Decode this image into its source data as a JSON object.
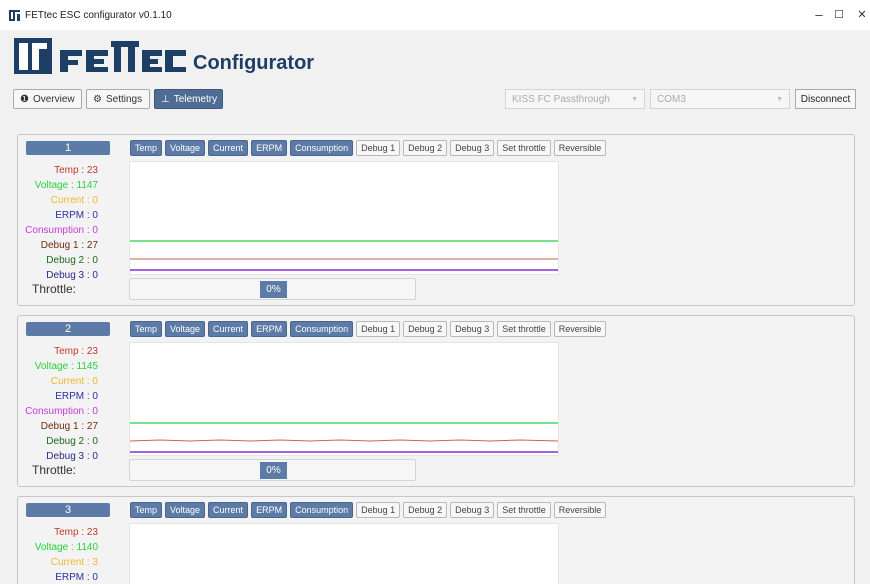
{
  "window": {
    "title": "FETtec ESC configurator v0.1.10",
    "minimize": "–",
    "maximize": "☐",
    "close": "✕"
  },
  "header": {
    "logo_text": "FETEC",
    "subtitle": "Configurator"
  },
  "nav": {
    "overview": {
      "label": "Overview",
      "icon": "info-icon"
    },
    "settings": {
      "label": "Settings",
      "icon": "gear-icon"
    },
    "telemetry": {
      "label": "Telemetry",
      "icon": "chart-icon"
    }
  },
  "controls": {
    "mode_select": "KISS FC Passthrough",
    "port_select": "COM3",
    "disconnect_label": "Disconnect"
  },
  "toggle_labels": [
    "Temp",
    "Voltage",
    "Current",
    "ERPM",
    "Consumption",
    "Debug 1",
    "Debug 2",
    "Debug 3",
    "Set throttle",
    "Reversible"
  ],
  "toggle_active": [
    true,
    true,
    true,
    true,
    true,
    false,
    false,
    false,
    false,
    false
  ],
  "colors": {
    "accent": "#5c7ba7",
    "temp": "#c0392b",
    "voltage": "#27d13a",
    "current": "#f2b631",
    "erpm": "#2c2ca8",
    "consumption": "#c53bd6"
  },
  "motors": [
    {
      "number": "1",
      "temp": "Temp : 23",
      "voltage": "Voltage : 1147",
      "current": "Current : 0",
      "erpm": "ERPM : 0",
      "consumption": "Consumption : 0",
      "debug1": "Debug 1 : 27",
      "debug2": "Debug 2 : 0",
      "debug3": "Debug 3 : 0",
      "throttle_label": "Throttle:",
      "throttle_value": "0%"
    },
    {
      "number": "2",
      "temp": "Temp : 23",
      "voltage": "Voltage : 1145",
      "current": "Current : 0",
      "erpm": "ERPM : 0",
      "consumption": "Consumption : 0",
      "debug1": "Debug 1 : 27",
      "debug2": "Debug 2 : 0",
      "debug3": "Debug 3 : 0",
      "throttle_label": "Throttle:",
      "throttle_value": "0%"
    },
    {
      "number": "3",
      "temp": "Temp : 23",
      "voltage": "Voltage : 1140",
      "current": "Current : 3",
      "erpm": "ERPM : 0"
    }
  ]
}
